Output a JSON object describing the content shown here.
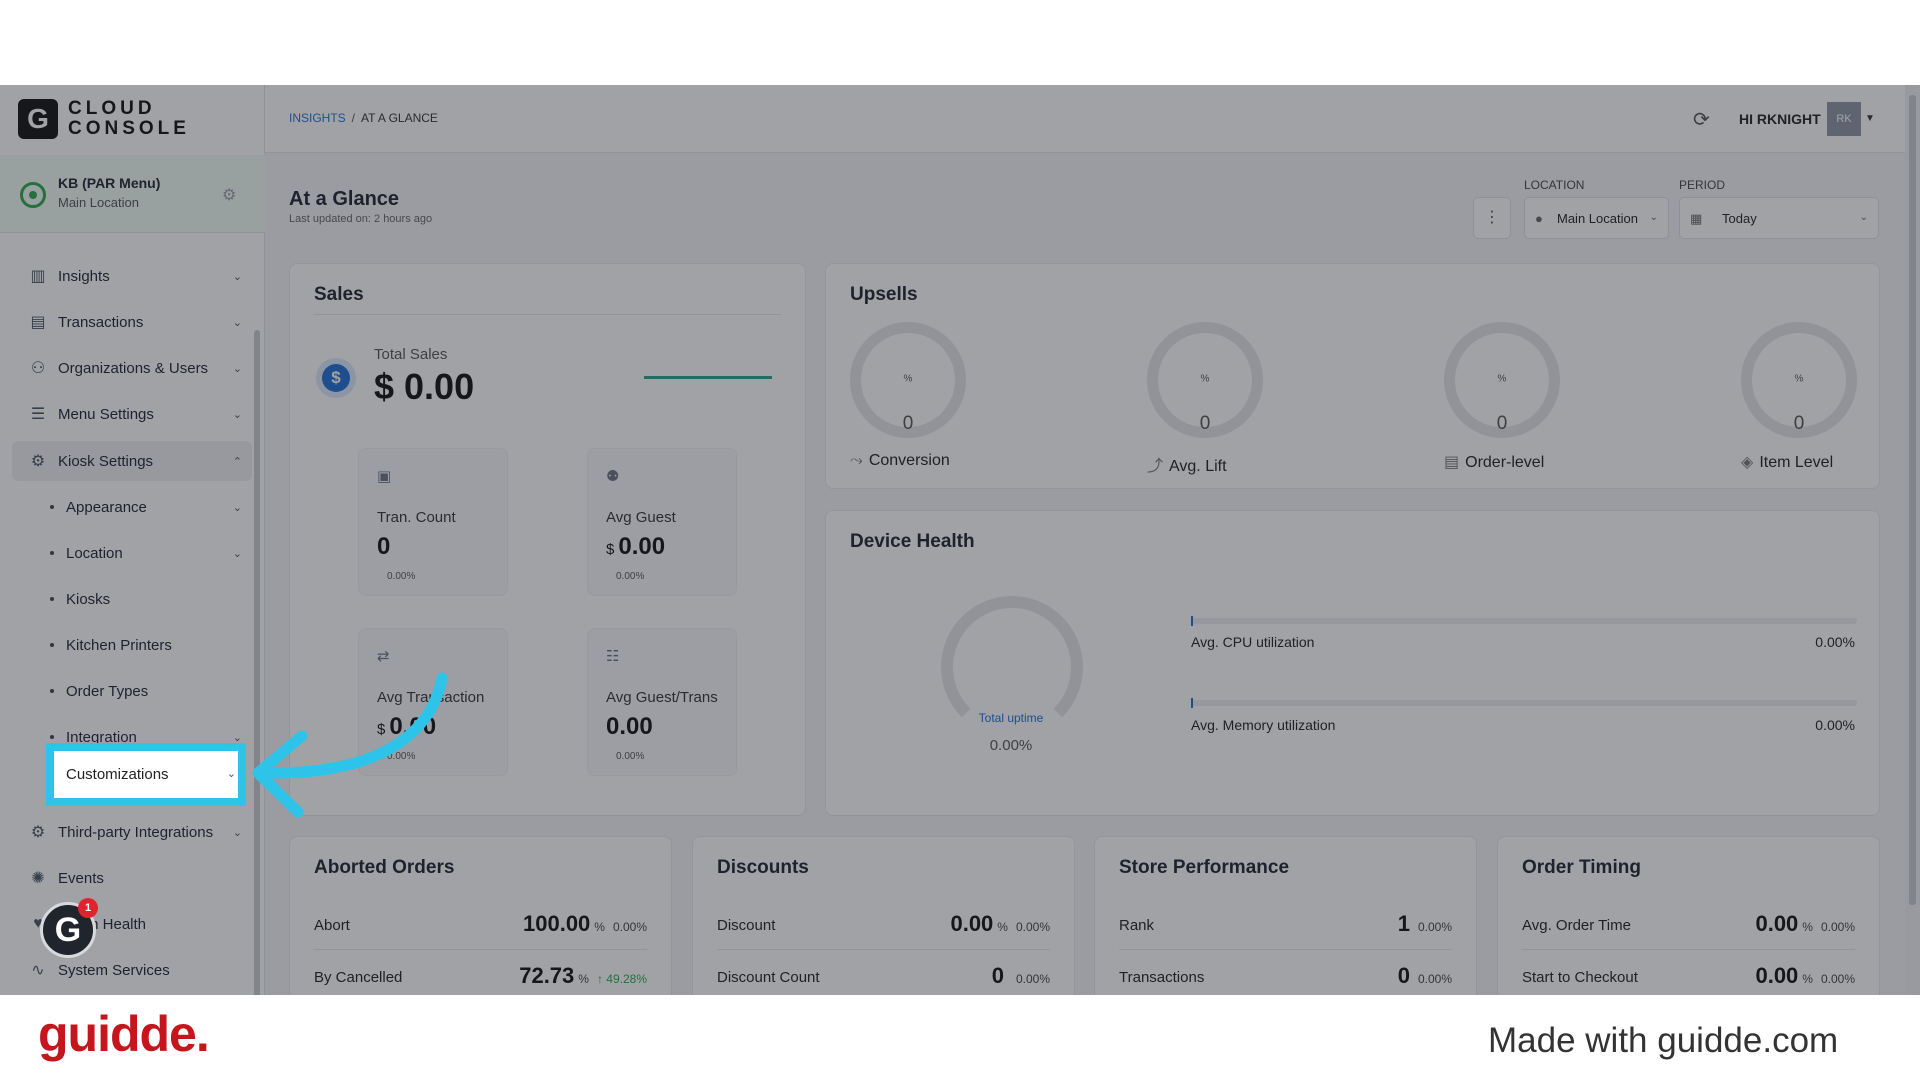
{
  "logo": {
    "mark": "G",
    "line1": "CLOUD",
    "line2": "CONSOLE"
  },
  "location": {
    "name": "KB (PAR Menu)",
    "sub": "Main Location"
  },
  "sidebar": {
    "items": [
      {
        "label": "Insights"
      },
      {
        "label": "Transactions"
      },
      {
        "label": "Organizations & Users"
      },
      {
        "label": "Menu Settings"
      },
      {
        "label": "Kiosk Settings"
      },
      {
        "label": "Appearance"
      },
      {
        "label": "Location"
      },
      {
        "label": "Kiosks"
      },
      {
        "label": "Kitchen Printers"
      },
      {
        "label": "Order Types"
      },
      {
        "label": "Integration"
      },
      {
        "label": "Customizations"
      },
      {
        "label": "Third-party Integrations"
      },
      {
        "label": "Events"
      },
      {
        "label": "m Health"
      },
      {
        "label": "System Services"
      }
    ]
  },
  "breadcrumb": {
    "root": "INSIGHTS",
    "sep": "/",
    "current": "AT A GLANCE"
  },
  "user": {
    "greeting": "HI RKNIGHT",
    "initials": "RK"
  },
  "page": {
    "title": "At a Glance",
    "updated": "Last updated on: 2 hours ago"
  },
  "filters": {
    "location_label": "LOCATION",
    "location_value": "Main Location",
    "period_label": "PERIOD",
    "period_value": "Today"
  },
  "sales": {
    "title": "Sales",
    "total_label": "Total Sales",
    "total_value": "$ 0.00",
    "tiles": [
      {
        "label": "Tran. Count",
        "currency": "",
        "value": "0",
        "pct": "0.00%"
      },
      {
        "label": "Avg Guest",
        "currency": "$",
        "value": "0.00",
        "pct": "0.00%"
      },
      {
        "label": "Avg Transaction",
        "currency": "$",
        "value": "0.00",
        "pct": "0.00%"
      },
      {
        "label": "Avg Guest/Trans",
        "currency": "",
        "value": "0.00",
        "pct": "0.00%"
      }
    ]
  },
  "upsells": {
    "title": "Upsells",
    "items": [
      {
        "value": "0",
        "unit": "%",
        "label": "Conversion"
      },
      {
        "value": "0",
        "unit": "%",
        "label": "Avg. Lift"
      },
      {
        "value": "0",
        "unit": "%",
        "label": "Order-level"
      },
      {
        "value": "0",
        "unit": "%",
        "label": "Item Level"
      }
    ]
  },
  "device_health": {
    "title": "Device Health",
    "uptime_label": "Total uptime",
    "uptime_value": "0.00%",
    "metrics": [
      {
        "label": "Avg. CPU utilization",
        "value": "0.00%"
      },
      {
        "label": "Avg. Memory utilization",
        "value": "0.00%"
      }
    ]
  },
  "aborted": {
    "title": "Aborted Orders",
    "rows": [
      {
        "label": "Abort",
        "value": "100.00",
        "unit": "%",
        "pct": "0.00%"
      },
      {
        "label": "By Cancelled",
        "value": "72.73",
        "unit": "%",
        "pct": "↑ 49.28%"
      }
    ]
  },
  "discounts": {
    "title": "Discounts",
    "rows": [
      {
        "label": "Discount",
        "value": "0.00",
        "unit": "%",
        "pct": "0.00%"
      },
      {
        "label": "Discount Count",
        "value": "0",
        "unit": "",
        "pct": "0.00%"
      }
    ]
  },
  "store": {
    "title": "Store Performance",
    "rows": [
      {
        "label": "Rank",
        "value": "1",
        "unit": "",
        "pct": "0.00%"
      },
      {
        "label": "Transactions",
        "value": "0",
        "unit": "",
        "pct": "0.00%"
      }
    ]
  },
  "timing": {
    "title": "Order Timing",
    "rows": [
      {
        "label": "Avg. Order Time",
        "value": "0.00",
        "unit": "%",
        "pct": "0.00%"
      },
      {
        "label": "Start to Checkout",
        "value": "0.00",
        "unit": "%",
        "pct": "0.00%"
      }
    ]
  },
  "badge": {
    "letter": "G",
    "count": "1"
  },
  "footer": {
    "brand": "guidde.",
    "made_with": "Made with guidde.com"
  },
  "colors": {
    "highlight": "#2ec4ea",
    "brand": "#c4161c",
    "link": "#1f6fd6"
  }
}
